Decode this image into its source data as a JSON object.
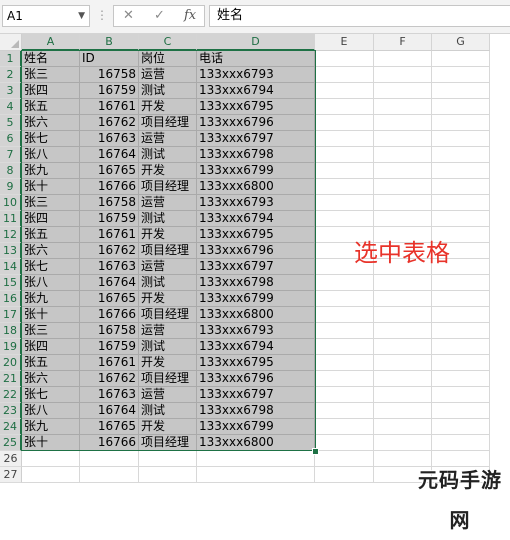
{
  "formula_bar": {
    "name_box": "A1",
    "cancel": "✕",
    "confirm": "✓",
    "fx": "fx",
    "formula": "姓名"
  },
  "columns": [
    "A",
    "B",
    "C",
    "D",
    "E",
    "F",
    "G"
  ],
  "rows": [
    [
      "姓名",
      "ID",
      "岗位",
      "电话"
    ],
    [
      "张三",
      "16758",
      "运营",
      "133xxx6793"
    ],
    [
      "张四",
      "16759",
      "测试",
      "133xxx6794"
    ],
    [
      "张五",
      "16761",
      "开发",
      "133xxx6795"
    ],
    [
      "张六",
      "16762",
      "项目经理",
      "133xxx6796"
    ],
    [
      "张七",
      "16763",
      "运营",
      "133xxx6797"
    ],
    [
      "张八",
      "16764",
      "测试",
      "133xxx6798"
    ],
    [
      "张九",
      "16765",
      "开发",
      "133xxx6799"
    ],
    [
      "张十",
      "16766",
      "项目经理",
      "133xxx6800"
    ],
    [
      "张三",
      "16758",
      "运营",
      "133xxx6793"
    ],
    [
      "张四",
      "16759",
      "测试",
      "133xxx6794"
    ],
    [
      "张五",
      "16761",
      "开发",
      "133xxx6795"
    ],
    [
      "张六",
      "16762",
      "项目经理",
      "133xxx6796"
    ],
    [
      "张七",
      "16763",
      "运营",
      "133xxx6797"
    ],
    [
      "张八",
      "16764",
      "测试",
      "133xxx6798"
    ],
    [
      "张九",
      "16765",
      "开发",
      "133xxx6799"
    ],
    [
      "张十",
      "16766",
      "项目经理",
      "133xxx6800"
    ],
    [
      "张三",
      "16758",
      "运营",
      "133xxx6793"
    ],
    [
      "张四",
      "16759",
      "测试",
      "133xxx6794"
    ],
    [
      "张五",
      "16761",
      "开发",
      "133xxx6795"
    ],
    [
      "张六",
      "16762",
      "项目经理",
      "133xxx6796"
    ],
    [
      "张七",
      "16763",
      "运营",
      "133xxx6797"
    ],
    [
      "张八",
      "16764",
      "测试",
      "133xxx6798"
    ],
    [
      "张九",
      "16765",
      "开发",
      "133xxx6799"
    ],
    [
      "张十",
      "16766",
      "项目经理",
      "133xxx6800"
    ],
    [],
    []
  ],
  "annotation": "选中表格",
  "watermark": "元码手游网",
  "colors": {
    "selection_border": "#1e7145",
    "selection_fill": "#c6c6c6",
    "annotation": "#e8332a"
  }
}
